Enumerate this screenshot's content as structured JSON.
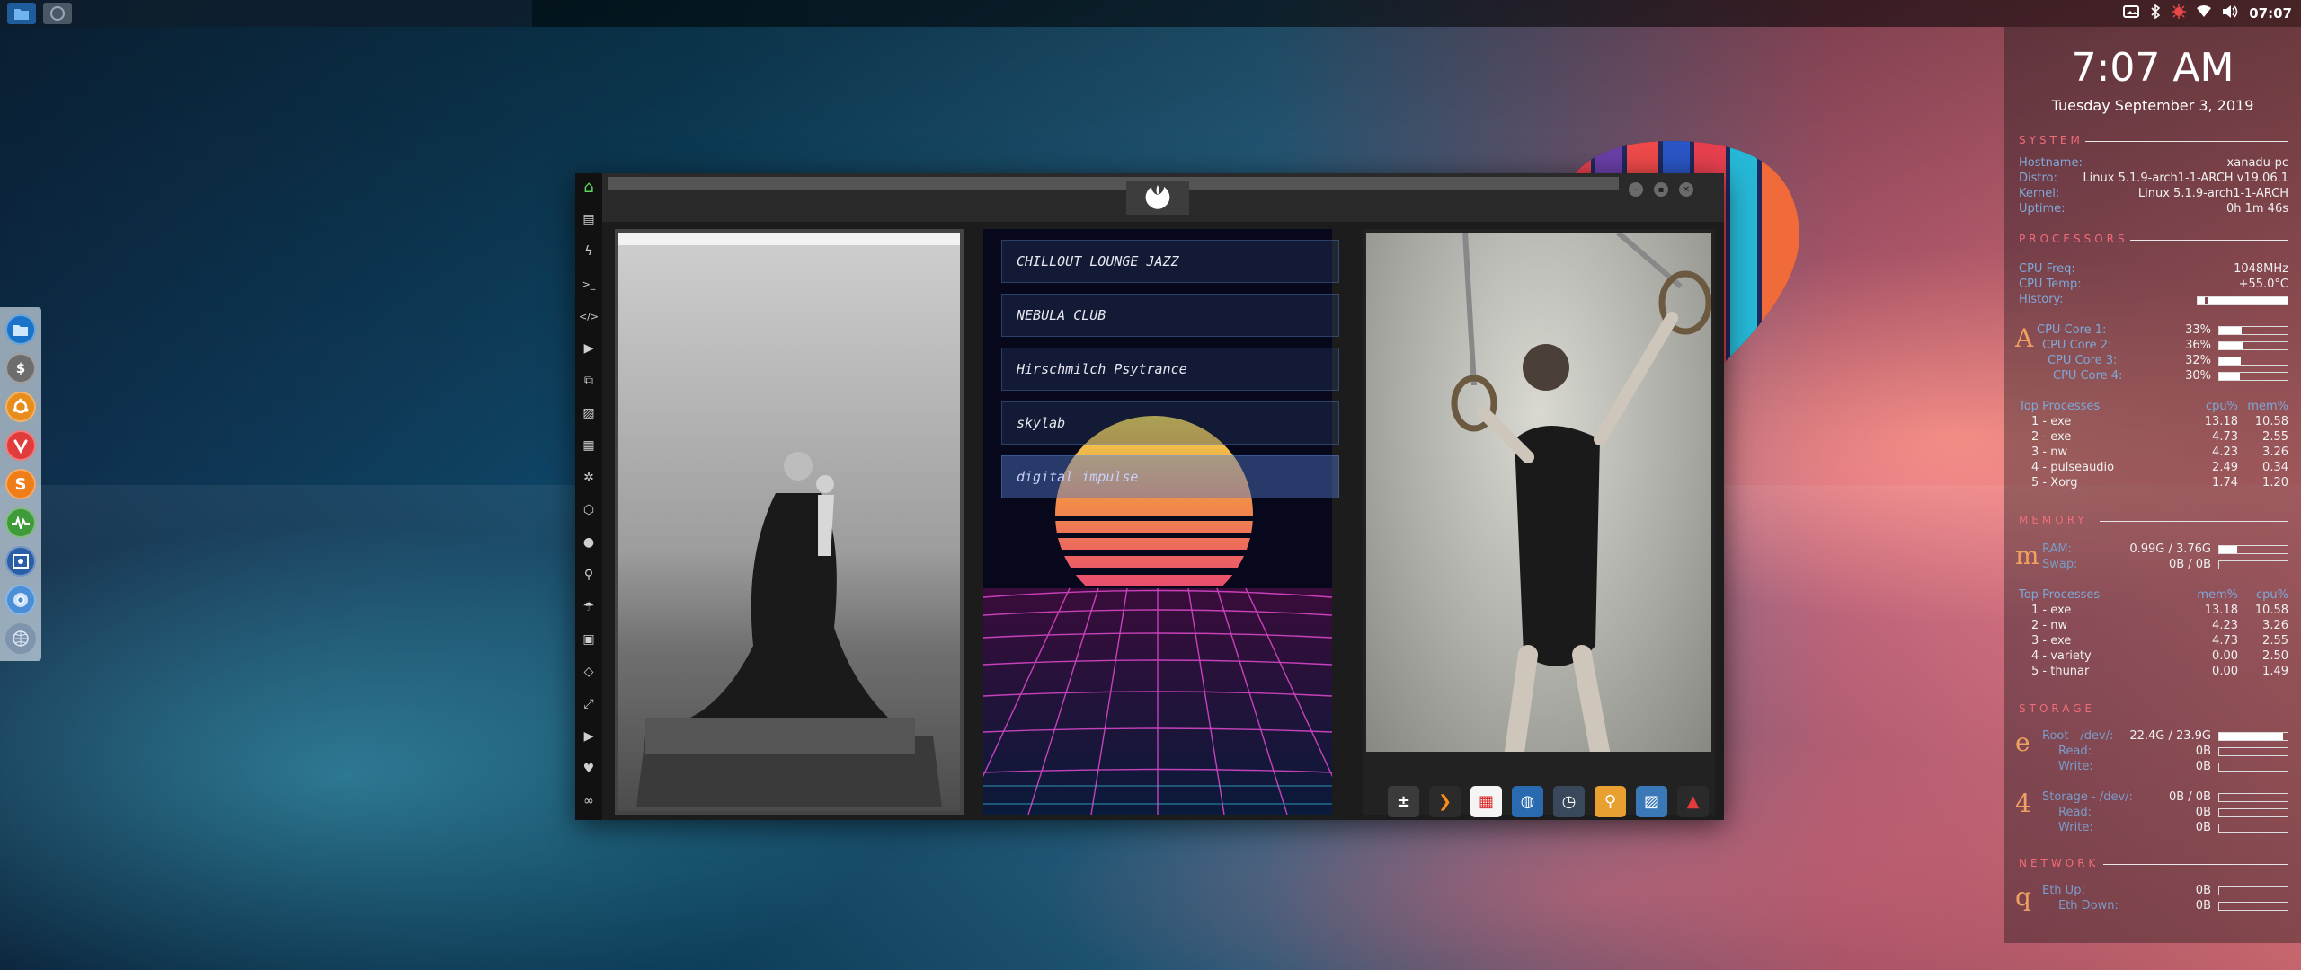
{
  "top_panel": {
    "clock": "07:07",
    "tray_icons": [
      "screenshot-icon",
      "bluetooth-icon",
      "virus-icon",
      "wifi-icon",
      "volume-icon"
    ]
  },
  "dock": {
    "items": [
      "file-manager-icon",
      "terminal-icon",
      "ubuntu-icon",
      "vivaldi-icon",
      "sublime-icon",
      "system-monitor-icon",
      "screenshot-app-icon",
      "chromium-icon",
      "network-icon"
    ],
    "sublime_letter": "S",
    "terminal_glyph": "$"
  },
  "conky": {
    "time": "7:07 AM",
    "date": "Tuesday September  3, 2019",
    "system": {
      "header": "SYSTEM",
      "rows": [
        {
          "label": "Hostname:",
          "value": "xanadu-pc"
        },
        {
          "label": "Distro:",
          "value": "Linux 5.1.9-arch1-1-ARCH v19.06.1"
        },
        {
          "label": "Kernel:",
          "value": "Linux 5.1.9-arch1-1-ARCH"
        },
        {
          "label": "Uptime:",
          "value": "0h 1m 46s"
        }
      ]
    },
    "processors": {
      "header": "PROCESSORS",
      "rows": [
        {
          "label": "CPU Freq:",
          "value": "1048MHz"
        },
        {
          "label": "CPU Temp:",
          "value": "+55.0°C"
        },
        {
          "label": "History:",
          "value": ""
        }
      ],
      "glyph": "A",
      "cores": [
        {
          "label": "CPU Core 1:",
          "value": "33%",
          "fill": 0.33
        },
        {
          "label": "CPU Core 2:",
          "value": "36%",
          "fill": 0.36
        },
        {
          "label": "CPU Core 3:",
          "value": "32%",
          "fill": 0.32
        },
        {
          "label": "CPU Core 4:",
          "value": "30%",
          "fill": 0.3
        }
      ],
      "top_header": "Top Processes",
      "col1": "cpu%",
      "col2": "mem%",
      "top": [
        {
          "name": "1 - exe",
          "a": "13.18",
          "b": "10.58"
        },
        {
          "name": "2 - exe",
          "a": "4.73",
          "b": "2.55"
        },
        {
          "name": "3 - nw",
          "a": "4.23",
          "b": "3.26"
        },
        {
          "name": "4 - pulseaudio",
          "a": "2.49",
          "b": "0.34"
        },
        {
          "name": "5 - Xorg",
          "a": "1.74",
          "b": "1.20"
        }
      ]
    },
    "memory": {
      "header": "MEMORY",
      "glyph": "m",
      "rows": [
        {
          "label": "RAM:",
          "value": "0.99G / 3.76G",
          "fill": 0.26
        },
        {
          "label": "Swap:",
          "value": "0B / 0B",
          "fill": 0
        }
      ],
      "top_header": "Top Processes",
      "col1": "mem%",
      "col2": "cpu%",
      "top": [
        {
          "name": "1 - exe",
          "a": "13.18",
          "b": "10.58"
        },
        {
          "name": "2 - nw",
          "a": "4.23",
          "b": "3.26"
        },
        {
          "name": "3 - exe",
          "a": "4.73",
          "b": "2.55"
        },
        {
          "name": "4 - variety",
          "a": "0.00",
          "b": "2.50"
        },
        {
          "name": "5 - thunar",
          "a": "0.00",
          "b": "1.49"
        }
      ]
    },
    "storage": {
      "header": "STORAGE",
      "glyph1": "e",
      "glyph2": "4",
      "rows1": [
        {
          "label": "Root - /dev/:",
          "value": "22.4G / 23.9G",
          "fill": 0.94
        },
        {
          "label": "Read:",
          "value": "0B",
          "fill": 0
        },
        {
          "label": "Write:",
          "value": "0B",
          "fill": 0
        }
      ],
      "rows2": [
        {
          "label": "Storage - /dev/:",
          "value": "0B / 0B",
          "fill": 0
        },
        {
          "label": "Read:",
          "value": "0B",
          "fill": 0
        },
        {
          "label": "Write:",
          "value": "0B",
          "fill": 0
        }
      ]
    },
    "network": {
      "header": "NETWORK",
      "glyph": "q",
      "rows": [
        {
          "label": "Eth Up:",
          "value": "0B",
          "fill": 0
        },
        {
          "label": "Eth Down:",
          "value": "0B",
          "fill": 0
        }
      ]
    }
  },
  "window": {
    "emblem": "rebel-alliance-icon",
    "sidebar_icons": [
      "home-icon",
      "document-icon",
      "bolt-icon",
      "terminal-prompt-icon",
      "code-icon",
      "play-icon",
      "copy-icon",
      "image-icon",
      "news-icon",
      "atom-icon",
      "hexagon-icon",
      "globe-icon",
      "search-icon",
      "umbrella-icon",
      "contact-icon",
      "diamond-icon",
      "expand-icon",
      "youtube-icon",
      "heart-icon",
      "link-icon"
    ],
    "stations": [
      {
        "label": "CHILLOUT LOUNGE JAZZ",
        "active": false
      },
      {
        "label": "NEBULA CLUB",
        "active": false
      },
      {
        "label": "Hirschmilch Psytrance",
        "active": false
      },
      {
        "label": "skylab",
        "active": false
      },
      {
        "label": "digital impulse",
        "active": true
      }
    ],
    "launcher": [
      "calculator-icon",
      "sublime-text-icon",
      "calendar-icon",
      "globe-browser-icon",
      "clock-icon",
      "search-magnifier-icon",
      "image-viewer-icon",
      "arch-icon"
    ]
  },
  "colors": {
    "accent": "#f06c78",
    "conky_label": "#7fa8d8",
    "home_icon": "#5cd65c"
  }
}
